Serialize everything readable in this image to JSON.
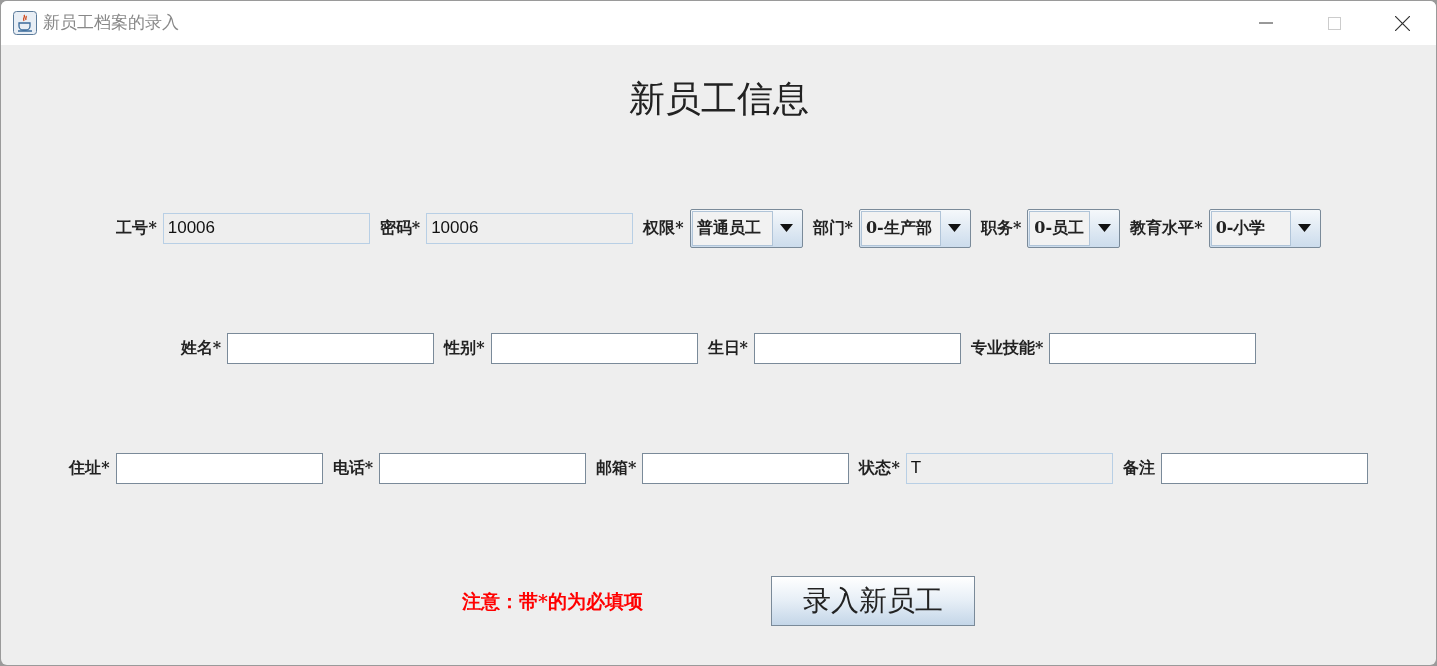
{
  "window": {
    "title": "新员工档案的录入"
  },
  "heading": "新员工信息",
  "rows": [
    [
      {
        "kind": "field",
        "label": "工号*",
        "value": "10006",
        "editable": false
      },
      {
        "kind": "field",
        "label": "密码*",
        "value": "10006",
        "editable": false
      },
      {
        "kind": "combo",
        "label": "权限*",
        "value": "普通员工"
      },
      {
        "kind": "combo",
        "label": "部门*",
        "value": "0-生产部"
      },
      {
        "kind": "combo",
        "label": "职务*",
        "value": "0-员工"
      },
      {
        "kind": "combo",
        "label": "教育水平*",
        "value": "0-小学"
      }
    ],
    [
      {
        "kind": "field",
        "label": "姓名*",
        "editable": true
      },
      {
        "kind": "field",
        "label": "性别*",
        "editable": true
      },
      {
        "kind": "field",
        "label": "生日*",
        "editable": true
      },
      {
        "kind": "field",
        "label": "专业技能*",
        "editable": true
      }
    ],
    [
      {
        "kind": "field",
        "label": "住址*",
        "editable": true
      },
      {
        "kind": "field",
        "label": "电话*",
        "editable": true
      },
      {
        "kind": "field",
        "label": "邮箱*",
        "editable": true
      },
      {
        "kind": "field",
        "label": "状态*",
        "value": "T",
        "editable": false
      },
      {
        "kind": "field",
        "label": "备注",
        "editable": true
      }
    ]
  ],
  "note": "注意：带*的为必填项",
  "submit_button": "录入新员工"
}
